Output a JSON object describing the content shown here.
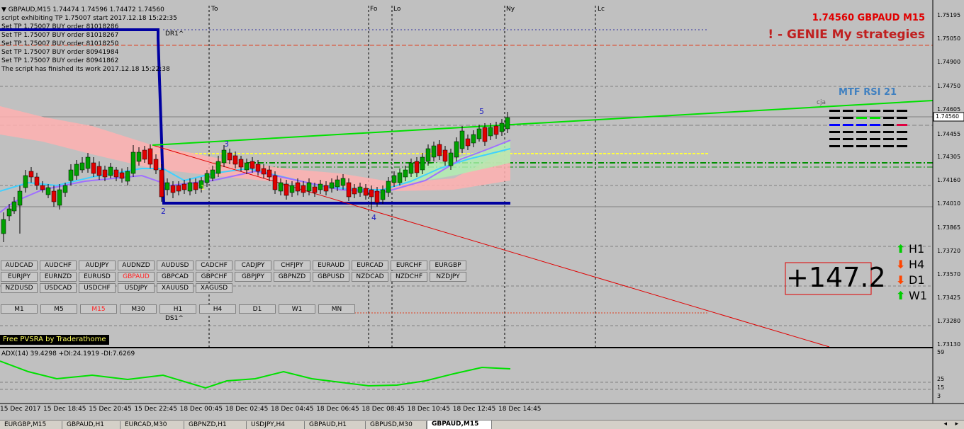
{
  "header": {
    "symbol_line": "GBPAUD,M15  1.74474 1.74596 1.74472 1.74560",
    "log_lines": [
      "script exhibiting TP 1.75007 start 2017.12.18 15:22:35",
      "Set TP 1.75007 BUY order 81018286",
      "Set TP 1.75007 BUY order 81018267",
      "Set TP 1.75007 BUY order 81018250",
      "Set TP 1.75007 BUY order 80941984",
      "Set TP 1.75007 BUY order 80941862",
      "The script has finished its work 2017.12.18 15:22:38"
    ]
  },
  "session_labels": [
    "To",
    "Fo",
    "Lo",
    "Ny",
    "Lc"
  ],
  "title_right": "1.74560 GBPAUD M15",
  "strategy_title": "! - GENIE My strategies",
  "mtf_rsi_label": "MTF RSI  21",
  "cja_label": "cja",
  "pips_value": "+147.2",
  "pattern_labels": [
    "DR1^",
    "DS1^",
    "1",
    "2",
    "3",
    "4",
    "5"
  ],
  "pair_buttons": [
    [
      "AUDCAD",
      "AUDCHF",
      "AUDJPY",
      "AUDNZD",
      "AUDUSD",
      "CADCHF",
      "CADJPY",
      "CHFJPY",
      "EURAUD",
      "EURCAD",
      "EURCHF",
      "EURGBP"
    ],
    [
      "EURJPY",
      "EURNZD",
      "EURUSD",
      "GBPAUD",
      "GBPCAD",
      "GBPCHF",
      "GBPJPY",
      "GBPNZD",
      "GBPUSD",
      "NZDCAD",
      "NZDCHF",
      "NZDJPY"
    ],
    [
      "NZDUSD",
      "USDCAD",
      "USDCHF",
      "USDJPY",
      "XAUUSD",
      "XAGUSD"
    ]
  ],
  "active_pair": "GBPAUD",
  "timeframes": [
    "M1",
    "M5",
    "M15",
    "M30",
    "H1",
    "H4",
    "D1",
    "W1",
    "MN"
  ],
  "active_timeframe": "M15",
  "tf_signals": [
    {
      "label": "H1",
      "dir": "up",
      "color": "#00cc00"
    },
    {
      "label": "H4",
      "dir": "down",
      "color": "#ff4400"
    },
    {
      "label": "D1",
      "dir": "down",
      "color": "#ff4400"
    },
    {
      "label": "W1",
      "dir": "up",
      "color": "#00cc00"
    }
  ],
  "pvsra_label": "Free  PVSRA  by  Traderathome",
  "adx_label": "ADX(14) 39.4298 +DI:24.1919 -DI:7.6269",
  "price_axis": [
    "1.75195",
    "1.75050",
    "1.74900",
    "1.74750",
    "1.74605",
    "1.74560",
    "1.74455",
    "1.74305",
    "1.74160",
    "1.74010",
    "1.73865",
    "1.73720",
    "1.73570",
    "1.73425",
    "1.73280",
    "1.73130"
  ],
  "current_price": "1.74560",
  "adx_axis": [
    "59",
    "25",
    "15",
    "3"
  ],
  "time_axis": [
    "15 Dec 2017",
    "15 Dec 18:45",
    "15 Dec 20:45",
    "15 Dec 22:45",
    "18 Dec 00:45",
    "18 Dec 02:45",
    "18 Dec 04:45",
    "18 Dec 06:45",
    "18 Dec 08:45",
    "18 Dec 10:45",
    "18 Dec 12:45",
    "18 Dec 14:45"
  ],
  "tabs": [
    "EURGBP,M15",
    "GBPAUD,H1",
    "EURCAD,M30",
    "GBPNZD,H1",
    "USDJPY,H4",
    "GBPAUD,H1",
    "GBPUSD,M30",
    "GBPAUD,M15"
  ],
  "active_tab": "GBPAUD,M15",
  "colors": {
    "bull": "#00a000",
    "bear": "#e00000",
    "wick": "#000000",
    "trend_blue": "#0000a0",
    "green_line": "#00e000",
    "red_line": "#e00000"
  }
}
